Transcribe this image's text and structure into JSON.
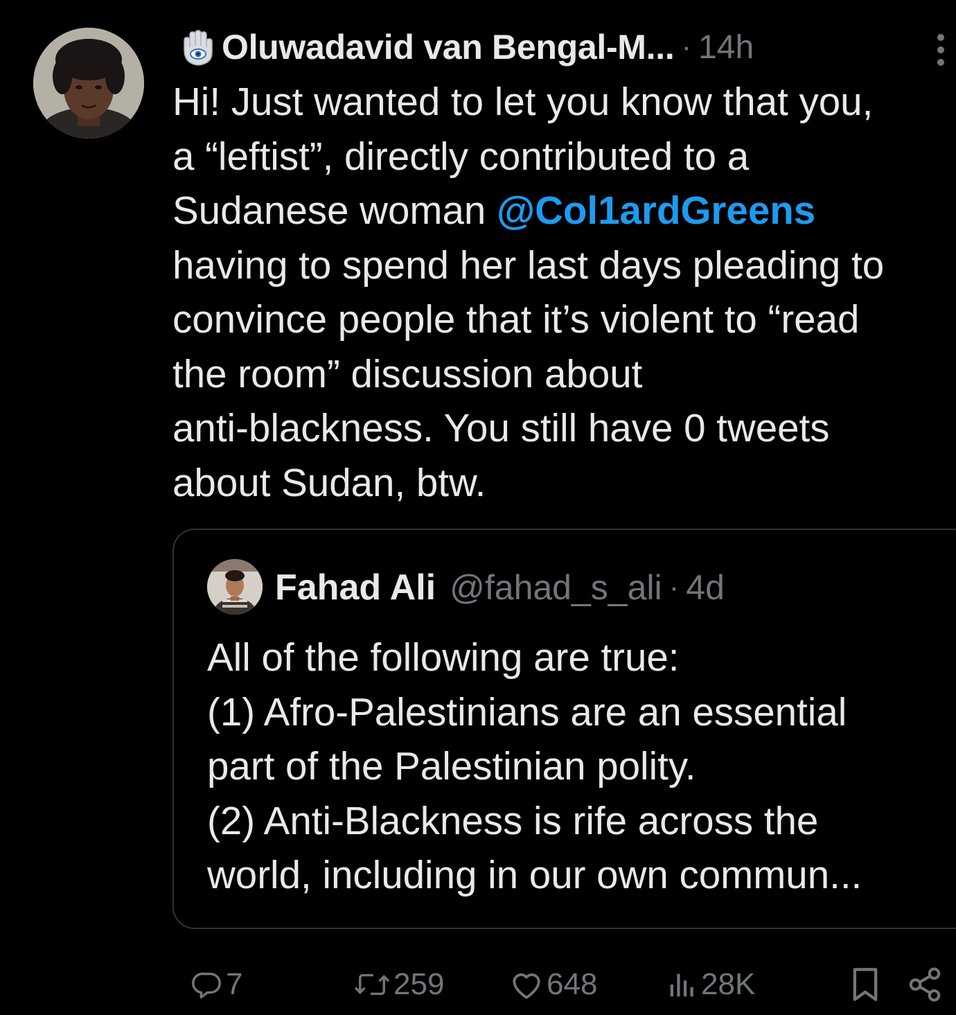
{
  "tweet": {
    "author_name": "Oluwadavid van Bengal-M...",
    "time": "14h",
    "separator": "·",
    "badge_icon": "hamsa-eye-icon",
    "text_lines": [
      "Hi! Just wanted to let you know that you,",
      "a “leftist”, directly contributed to a",
      "@Col1ardGreens",
      "having to spend her last days pleading to",
      "convince people that it’s violent to “read",
      "the room” discussion about",
      "anti-blackness. You still have 0 tweets",
      "about Sudan, btw."
    ],
    "line3_prefix": "Sudanese woman ",
    "mention": "@Col1ardGreens",
    "mention_color": "#1d9bf0"
  },
  "quote": {
    "name": "Fahad Ali",
    "handle": "@fahad_s_ali",
    "separator": "·",
    "time": "4d",
    "text_lines": [
      "All of the following are true:",
      "(1) Afro-Palestinians are an essential",
      "part of the Palestinian polity.",
      "(2) Anti-Blackness is rife across the",
      "world, including in our own commun..."
    ]
  },
  "actions": {
    "replies": "7",
    "retweets": "259",
    "likes": "648",
    "views": "28K",
    "icons": [
      "reply-icon",
      "retweet-icon",
      "like-icon",
      "views-icon",
      "bookmark-icon",
      "share-icon"
    ]
  },
  "colors": {
    "background": "#000000",
    "text": "#e7e9ea",
    "muted": "#71767b",
    "border": "#2f3336",
    "accent": "#1d9bf0"
  }
}
